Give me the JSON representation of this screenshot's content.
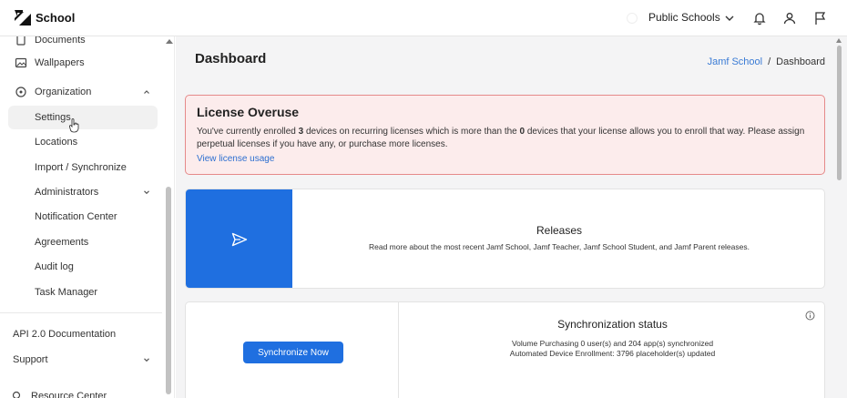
{
  "app": {
    "brand": "School"
  },
  "header": {
    "org_name": "Public Schools"
  },
  "sidebar": {
    "items": [
      {
        "label": "Documents"
      },
      {
        "label": "Wallpapers"
      },
      {
        "label": "Organization"
      },
      {
        "label": "Settings"
      },
      {
        "label": "Locations"
      },
      {
        "label": "Import / Synchronize"
      },
      {
        "label": "Administrators"
      },
      {
        "label": "Notification Center"
      },
      {
        "label": "Agreements"
      },
      {
        "label": "Audit log"
      },
      {
        "label": "Task Manager"
      },
      {
        "label": "API 2.0 Documentation"
      },
      {
        "label": "Support"
      },
      {
        "label": "Resource Center"
      }
    ]
  },
  "main": {
    "title": "Dashboard",
    "breadcrumb": {
      "link": "Jamf School",
      "separator": "/",
      "current": "Dashboard"
    },
    "alert": {
      "title": "License Overuse",
      "text_1": "You've currently enrolled ",
      "count_enrolled": "3",
      "text_2": " devices on recurring licenses which is more than the ",
      "count_allowed": "0",
      "text_3": " devices that your license allows you to enroll that way. Please assign perpetual licenses if you have any, or purchase more licenses.",
      "link": "View license usage"
    },
    "releases": {
      "title": "Releases",
      "description": "Read more about the most recent Jamf School, Jamf Teacher, Jamf School Student, and Jamf Parent releases."
    },
    "sync": {
      "button": "Synchronize Now",
      "title": "Synchronization status",
      "line_1": "Volume Purchasing 0 user(s) and 204 app(s) synchronized",
      "line_2": "Automated Device Enrollment: 3796 placeholder(s) updated"
    }
  },
  "colors": {
    "accent": "#1f6fe0",
    "alert_bg": "#fcecec",
    "alert_border": "#e58a8a",
    "link": "#2d6fd0"
  }
}
